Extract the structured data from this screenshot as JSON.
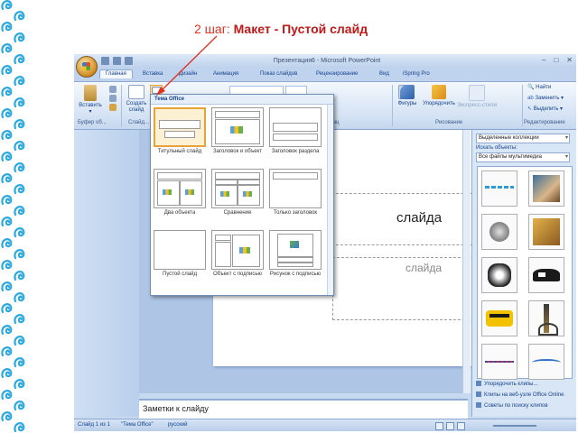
{
  "caption": {
    "prefix": "2 шаг: ",
    "main": "Макет - Пустой слайд"
  },
  "window": {
    "title": "Презентация6 - Microsoft PowerPoint",
    "tabs": [
      "Главная",
      "Вставка",
      "Дизайн",
      "Анимация",
      "Показ слайдов",
      "Рецензирование",
      "Вид",
      "iSpring Pro"
    ],
    "active_tab": "Главная"
  },
  "ribbon": {
    "paste": "Вставить",
    "create_slide": "Создать слайд",
    "clipboard_group": "Буфер об...",
    "slides_group": "Слайд...",
    "paragraph_group": "зац",
    "drawing_group": "Рисование",
    "edit_group": "Редактирование",
    "shapes": "Фигуры",
    "arrange": "Упорядочить",
    "quick_styles": "Экспресс-стили",
    "find": "Найти",
    "replace": "Заменить",
    "select": "Выделить"
  },
  "gallery": {
    "header": "Тема Office",
    "layouts": [
      "Титульный слайд",
      "Заголовок и объект",
      "Заголовок раздела",
      "Два объекта",
      "Сравнение",
      "Только заголовок",
      "Пустой слайд",
      "Объект с подписью",
      "Рисунок с подписью"
    ],
    "selected": "Титульный слайд"
  },
  "slide": {
    "title_fragment": "слайда",
    "subtitle_fragment": "слайда"
  },
  "notes_placeholder": "Заметки к слайду",
  "status": {
    "slide_no": "Слайд 1 из 1",
    "theme": "\"Тема Office\"",
    "language": "русский"
  },
  "taskpane": {
    "search_in_value": "Выделенные коллекции",
    "search_objects_label": "Искать объекты:",
    "media_type_value": "Все файлы мультимедиа",
    "links": [
      "Упорядочить клипы...",
      "Клипы на веб-узле Office Online",
      "Советы по поиску клипов"
    ]
  },
  "colors": {
    "caption_red": "#c01818",
    "accent_blue": "#15428b",
    "selection_orange": "#e8a23a"
  }
}
